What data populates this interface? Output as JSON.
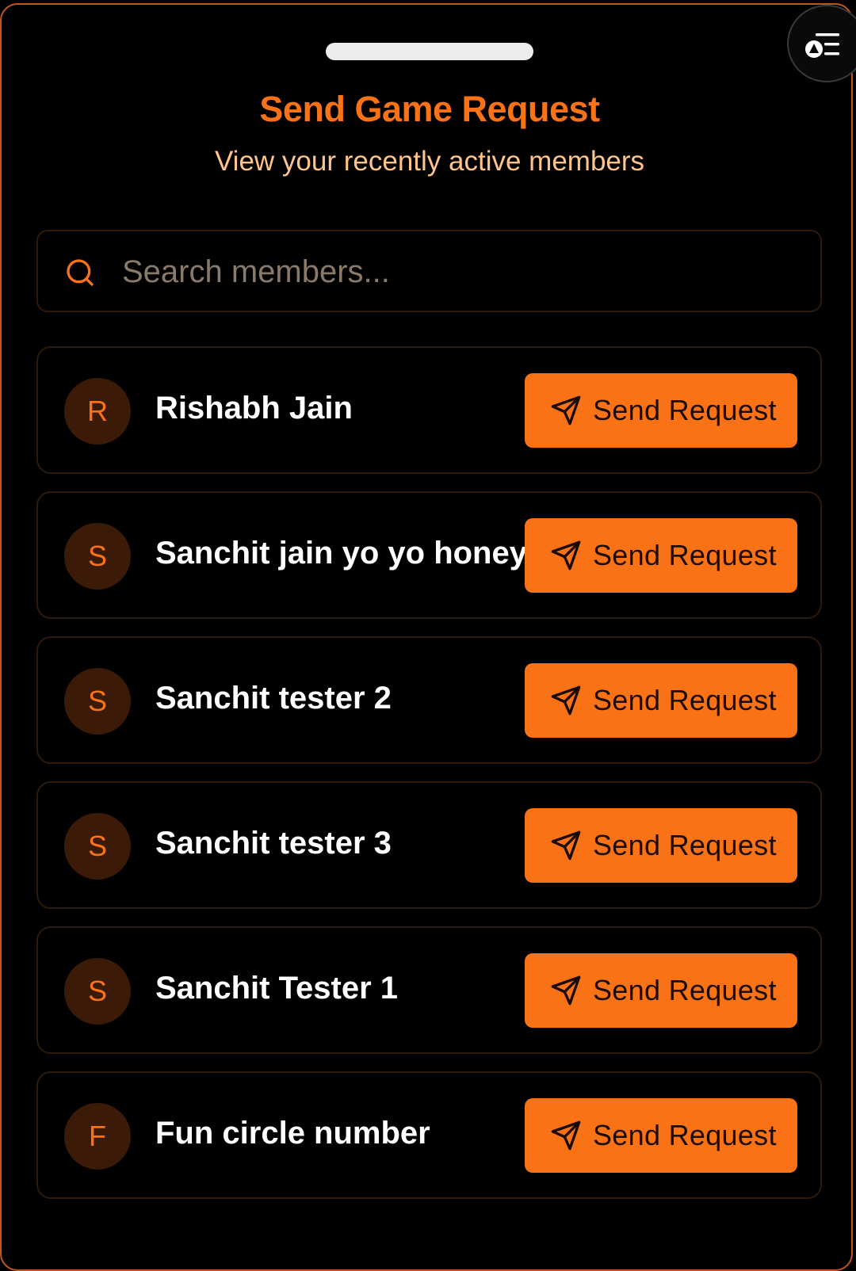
{
  "header": {
    "title": "Send Game Request",
    "subtitle": "View your recently active members"
  },
  "search": {
    "placeholder": "Search members...",
    "value": ""
  },
  "members": [
    {
      "initial": "R",
      "name": "Rishabh Jain",
      "action_label": "Send Request"
    },
    {
      "initial": "S",
      "name": "Sanchit jain yo yo honey",
      "action_label": "Send Request"
    },
    {
      "initial": "S",
      "name": "Sanchit tester 2",
      "action_label": "Send Request"
    },
    {
      "initial": "S",
      "name": "Sanchit tester 3",
      "action_label": "Send Request"
    },
    {
      "initial": "S",
      "name": "Sanchit Tester 1",
      "action_label": "Send Request"
    },
    {
      "initial": "F",
      "name": "Fun circle number",
      "action_label": "Send Request"
    }
  ],
  "icons": {
    "search": "search-icon",
    "send": "send-icon",
    "menu": "menu-shapes-icon"
  },
  "colors": {
    "accent": "#f97316",
    "subtitle": "#fdc58c",
    "avatar_bg": "#3b1a08",
    "background": "#000000"
  }
}
